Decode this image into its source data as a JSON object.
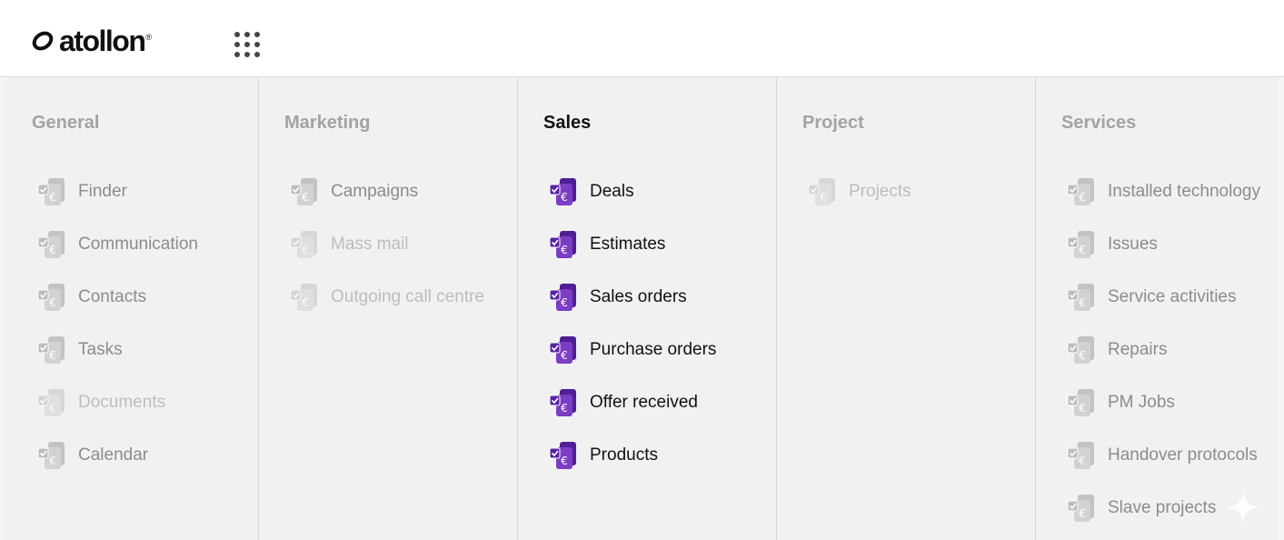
{
  "brand": {
    "name": "atollon",
    "reg": "®"
  },
  "colors": {
    "accent": "#6a2eb4",
    "muted_icon": "#c9c9c9",
    "title_inactive": "#a3a3a3",
    "title_active": "#111111"
  },
  "columns": [
    {
      "title": "General",
      "active": false,
      "items": [
        {
          "label": "Finder",
          "state": "normal"
        },
        {
          "label": "Communication",
          "state": "normal"
        },
        {
          "label": "Contacts",
          "state": "normal"
        },
        {
          "label": "Tasks",
          "state": "normal"
        },
        {
          "label": "Documents",
          "state": "faded"
        },
        {
          "label": "Calendar",
          "state": "normal"
        }
      ]
    },
    {
      "title": "Marketing",
      "active": false,
      "items": [
        {
          "label": "Campaigns",
          "state": "normal"
        },
        {
          "label": "Mass mail",
          "state": "faded"
        },
        {
          "label": "Outgoing call centre",
          "state": "faded"
        }
      ]
    },
    {
      "title": "Sales",
      "active": true,
      "items": [
        {
          "label": "Deals",
          "state": "active"
        },
        {
          "label": "Estimates",
          "state": "active"
        },
        {
          "label": "Sales orders",
          "state": "active"
        },
        {
          "label": "Purchase orders",
          "state": "active"
        },
        {
          "label": "Offer received",
          "state": "active"
        },
        {
          "label": "Products",
          "state": "active"
        }
      ]
    },
    {
      "title": "Project",
      "active": false,
      "items": [
        {
          "label": "Projects",
          "state": "faded"
        }
      ]
    },
    {
      "title": "Services",
      "active": false,
      "items": [
        {
          "label": "Installed technology",
          "state": "normal"
        },
        {
          "label": "Issues",
          "state": "normal"
        },
        {
          "label": "Service activities",
          "state": "normal"
        },
        {
          "label": "Repairs",
          "state": "normal"
        },
        {
          "label": "PM Jobs",
          "state": "normal"
        },
        {
          "label": "Handover protocols",
          "state": "normal"
        },
        {
          "label": "Slave projects",
          "state": "normal"
        }
      ]
    }
  ],
  "icons": {
    "app_grid": "grid-dots-icon",
    "module": "document-euro-icon",
    "corner": "sparkle-icon"
  }
}
